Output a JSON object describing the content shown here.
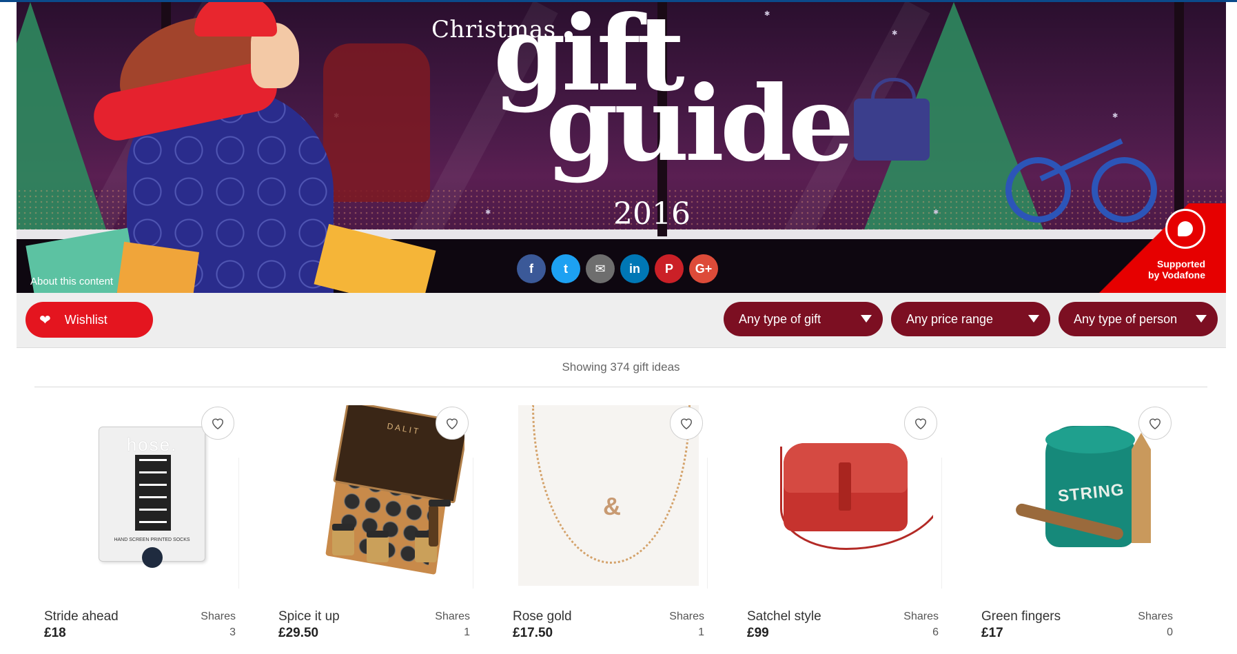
{
  "banner": {
    "title_christmas": "Christmas",
    "title_gift": "gift",
    "title_guide": "guide",
    "title_year": "2016",
    "about_link": "About this content",
    "sponsor_line1": "Supported",
    "sponsor_line2": "by Vodafone",
    "share_buttons": [
      {
        "icon": "facebook-icon",
        "glyph": "f",
        "color": "#3b5998"
      },
      {
        "icon": "twitter-icon",
        "glyph": "t",
        "color": "#1da1f2"
      },
      {
        "icon": "email-icon",
        "glyph": "✉",
        "color": "#6e6e6e"
      },
      {
        "icon": "linkedin-icon",
        "glyph": "in",
        "color": "#0077b5"
      },
      {
        "icon": "pinterest-icon",
        "glyph": "P",
        "color": "#cb2027"
      },
      {
        "icon": "google-plus-icon",
        "glyph": "G+",
        "color": "#dd4b39"
      }
    ]
  },
  "toolbar": {
    "wishlist_label": "Wishlist",
    "filters": [
      {
        "label": "Any type of gift"
      },
      {
        "label": "Any price range"
      },
      {
        "label": "Any type of person"
      }
    ]
  },
  "results": {
    "count_text": "Showing 374 gift ideas"
  },
  "products": [
    {
      "name": "Stride ahead",
      "price": "£18",
      "shares_label": "Shares",
      "shares": "3",
      "brand_text": "hose.",
      "caption": "HAND SCREEN PRINTED SOCKS"
    },
    {
      "name": "Spice it up",
      "price": "£29.50",
      "shares_label": "Shares",
      "shares": "1",
      "brand_text": "DALIT"
    },
    {
      "name": "Rose gold",
      "price": "£17.50",
      "shares_label": "Shares",
      "shares": "1",
      "pendant": "&"
    },
    {
      "name": "Satchel style",
      "price": "£99",
      "shares_label": "Shares",
      "shares": "6"
    },
    {
      "name": "Green fingers",
      "price": "£17",
      "shares_label": "Shares",
      "shares": "0",
      "tin_text": "STRING"
    }
  ],
  "colors": {
    "wishlist": "#e4151f",
    "filter": "#7c0f22",
    "banner_bg": "#4b1b49",
    "vodafone": "#e60000"
  }
}
